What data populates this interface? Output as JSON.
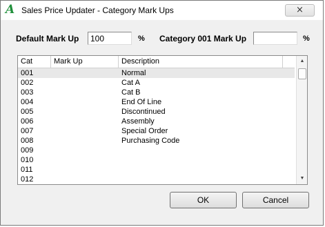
{
  "window": {
    "title": "Sales Price Updater - Category Mark Ups",
    "app_icon": "A",
    "close_glyph": "×"
  },
  "form": {
    "default_markup_label": "Default Mark Up",
    "default_markup_value": "100",
    "default_pct": "%",
    "category_markup_label": "Category 001 Mark Up",
    "category_markup_value": "",
    "category_pct": "%"
  },
  "grid": {
    "columns": [
      "Cat",
      "Mark Up",
      "Description"
    ],
    "rows": [
      {
        "cat": "001",
        "markup": "",
        "desc": "Normal"
      },
      {
        "cat": "002",
        "markup": "",
        "desc": "Cat A"
      },
      {
        "cat": "003",
        "markup": "",
        "desc": "Cat B"
      },
      {
        "cat": "004",
        "markup": "",
        "desc": "End Of Line"
      },
      {
        "cat": "005",
        "markup": "",
        "desc": "Discontinued"
      },
      {
        "cat": "006",
        "markup": "",
        "desc": "Assembly"
      },
      {
        "cat": "007",
        "markup": "",
        "desc": "Special Order"
      },
      {
        "cat": "008",
        "markup": "",
        "desc": "Purchasing Code"
      },
      {
        "cat": "009",
        "markup": "",
        "desc": ""
      },
      {
        "cat": "010",
        "markup": "",
        "desc": ""
      },
      {
        "cat": "011",
        "markup": "",
        "desc": ""
      },
      {
        "cat": "012",
        "markup": "",
        "desc": ""
      }
    ],
    "scroll_up_glyph": "▲",
    "scroll_down_glyph": "▼"
  },
  "buttons": {
    "ok": "OK",
    "cancel": "Cancel"
  },
  "colors": {
    "app_icon": "#1f8f3a",
    "selected_row": "#e8e8e8"
  }
}
